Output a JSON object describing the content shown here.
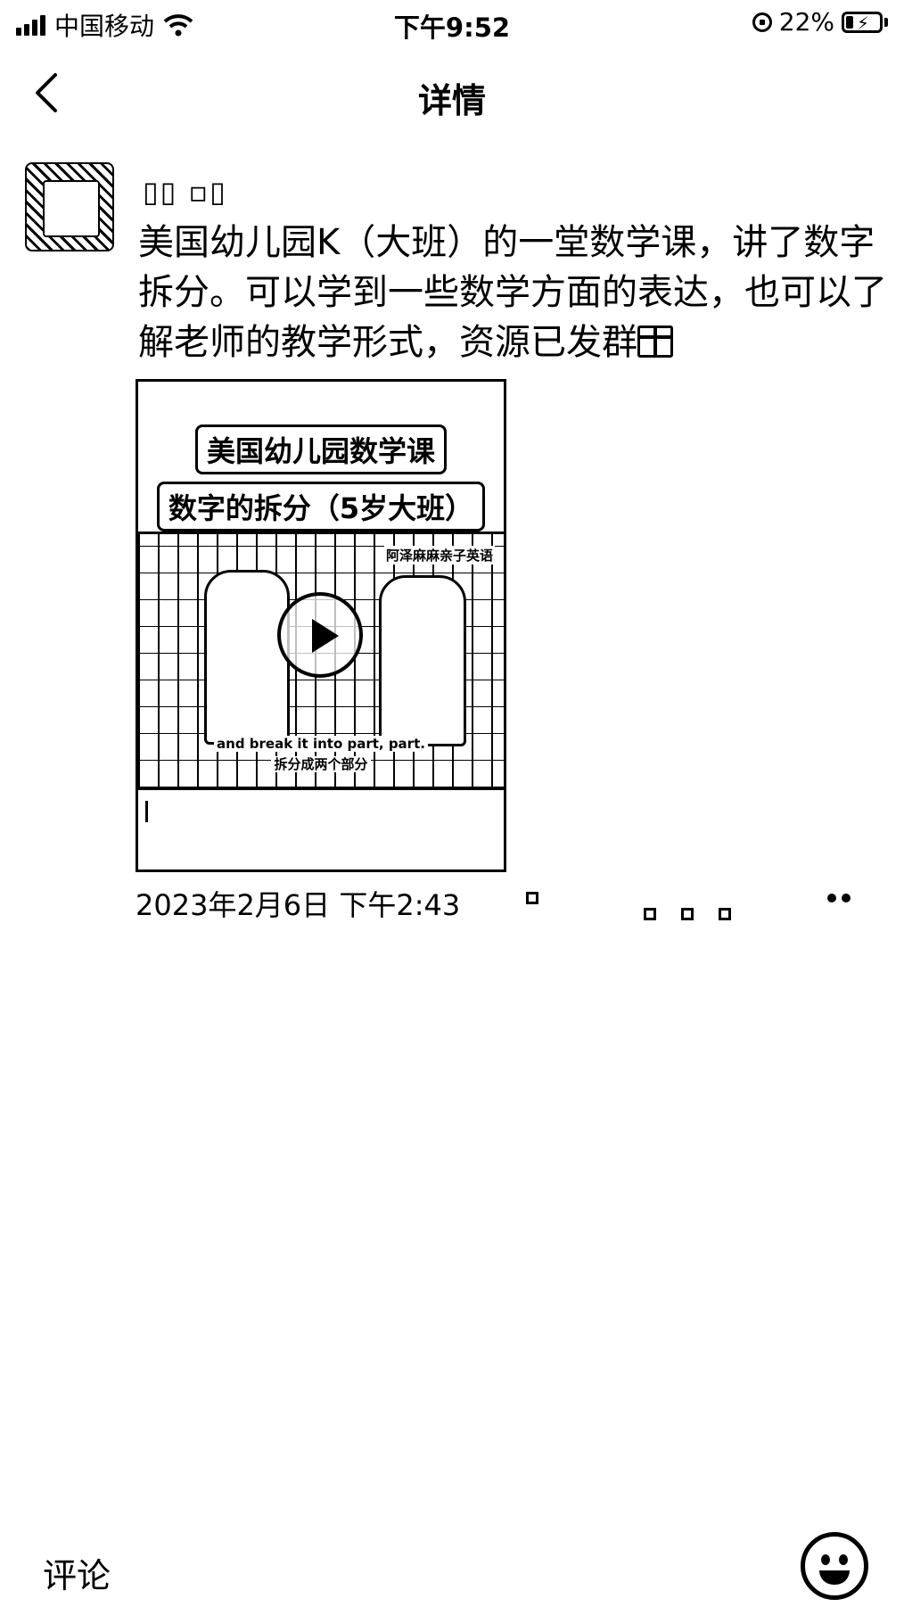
{
  "status_bar": {
    "carrier": "中国移动",
    "time": "下午9:52",
    "battery_percent": "22%",
    "battery_level": 0.22,
    "icons": [
      "signal-icon",
      "wifi-icon",
      "orientation-lock-icon",
      "battery-charging-icon"
    ]
  },
  "nav": {
    "title": "详情",
    "back_icon": "chevron-left-icon"
  },
  "post": {
    "author_name": "▯▯  ▫▯",
    "text": "美国幼儿园K（大班）的一堂数学课，讲了数字拆分。可以学到一些数学方面的表达，也可以了解老师的教学形式，资源已发群",
    "text_icon": "gift-icon",
    "timestamp": "2023年2月6日 下午2:43",
    "video": {
      "title_line1": "美国幼儿园数学课",
      "title_line2": "数字的拆分（5岁大班）",
      "watermark": "阿泽麻麻亲子英语",
      "subtitle_en": "and break it into part, part.",
      "subtitle_zh": "拆分成两个部分"
    }
  },
  "comment_bar": {
    "placeholder": "评论",
    "emoji_icon": "smiley-face-icon"
  }
}
